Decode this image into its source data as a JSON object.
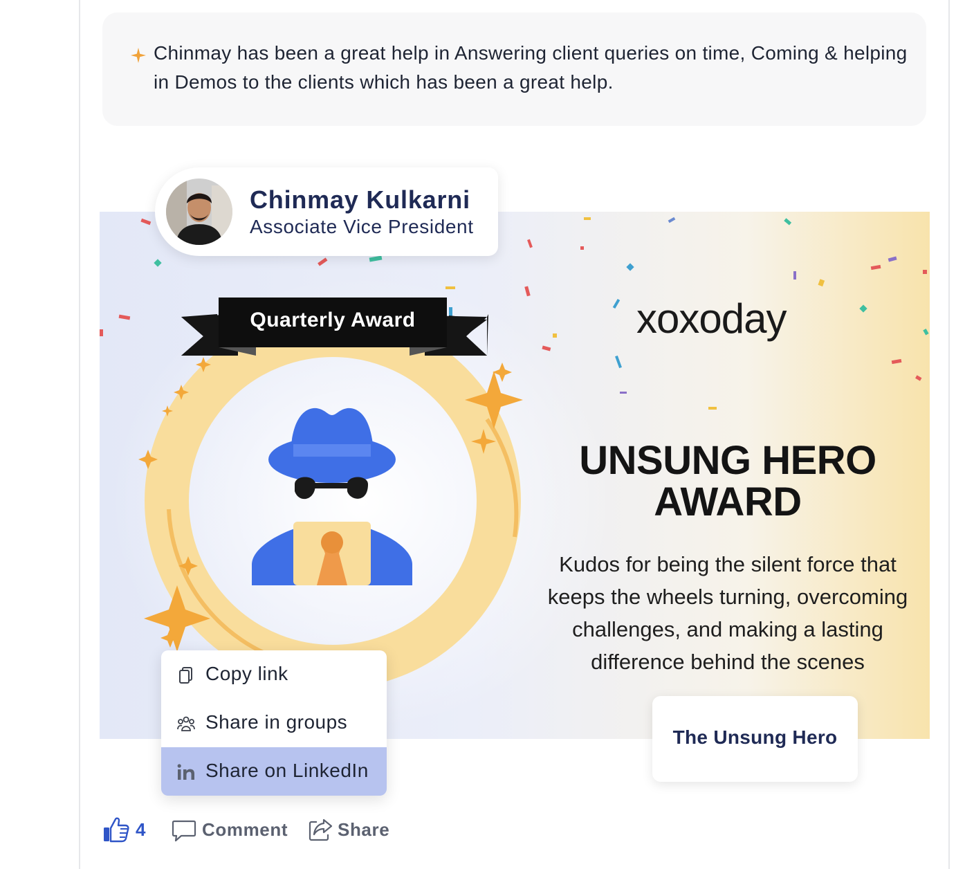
{
  "message": {
    "text": "Chinmay has been a great help in Answering client queries on time, Coming & helping in Demos to the clients which has been a great help.",
    "sparkle_icon": "sparkle-icon",
    "sparkle_color": "#f0a23a"
  },
  "profile": {
    "name": "Chinmay Kulkarni",
    "role": "Associate Vice President",
    "avatar_icon": "avatar-photo"
  },
  "award": {
    "ribbon_label": "Quarterly Award",
    "brand": "xoxoday",
    "title_line1": "UNSUNG HERO",
    "title_line2": "AWARD",
    "description": "Kudos for being the silent force that keeps the wheels turning, overcoming challenges, and making a lasting difference behind the scenes",
    "tag": "The Unsung Hero",
    "ring_color": "#f9dd9c",
    "hat_color": "#3f6fe6"
  },
  "share_menu": {
    "items": [
      {
        "label": "Copy link",
        "icon": "copy-icon"
      },
      {
        "label": "Share in groups",
        "icon": "group-icon"
      },
      {
        "label": "Share on LinkedIn",
        "icon": "linkedin-icon"
      }
    ],
    "active_index": 2,
    "active_color": "#b7c3ef"
  },
  "actions": {
    "like_count": "4",
    "comment_label": "Comment",
    "share_label": "Share",
    "like_color": "#2f55c7"
  }
}
